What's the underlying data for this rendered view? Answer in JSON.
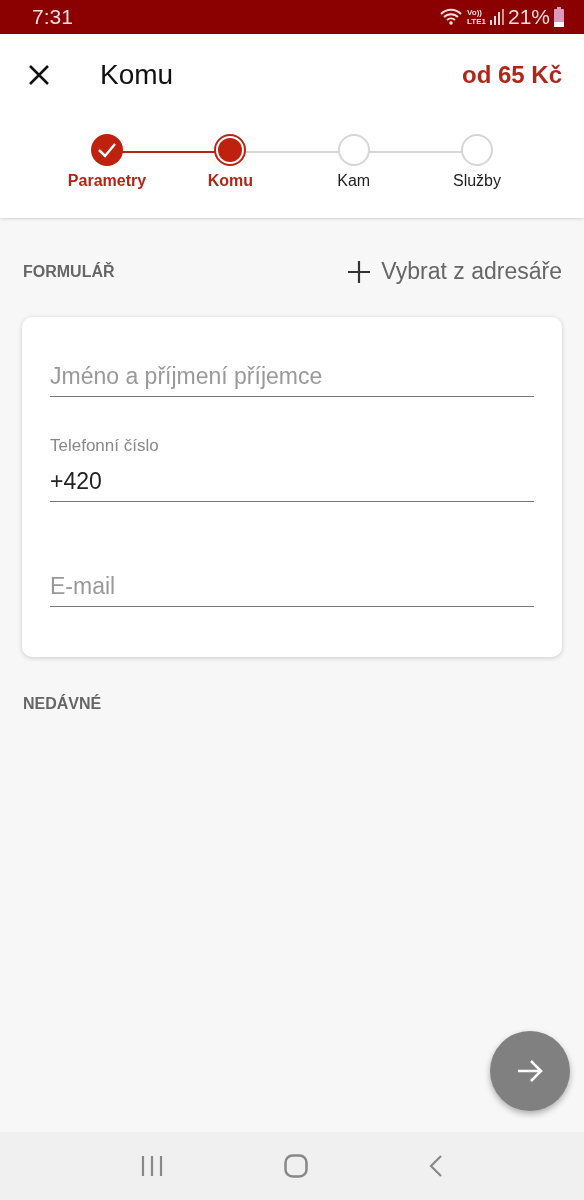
{
  "status_bar": {
    "time": "7:31",
    "volte": "Vo))",
    "lte": "LTE1",
    "battery": "21%"
  },
  "header": {
    "title": "Komu",
    "price": "od 65 Kč"
  },
  "steps": [
    {
      "label": "Parametry",
      "completed": true,
      "selected": false
    },
    {
      "label": "Komu",
      "completed": false,
      "selected": true
    },
    {
      "label": "Kam",
      "completed": false,
      "selected": false
    },
    {
      "label": "Služby",
      "completed": false,
      "selected": false
    }
  ],
  "form_section": {
    "title": "FORMULÁŘ",
    "action": "Vybrat z adresáře"
  },
  "fields": [
    {
      "kind": "empty",
      "placeholder": "Jméno a příjmení příjemce"
    },
    {
      "kind": "filled",
      "label": "Telefonní číslo",
      "value": "+420"
    },
    {
      "kind": "empty",
      "placeholder": "E-mail"
    }
  ],
  "recent_section": {
    "title": "NEDÁVNÉ"
  }
}
